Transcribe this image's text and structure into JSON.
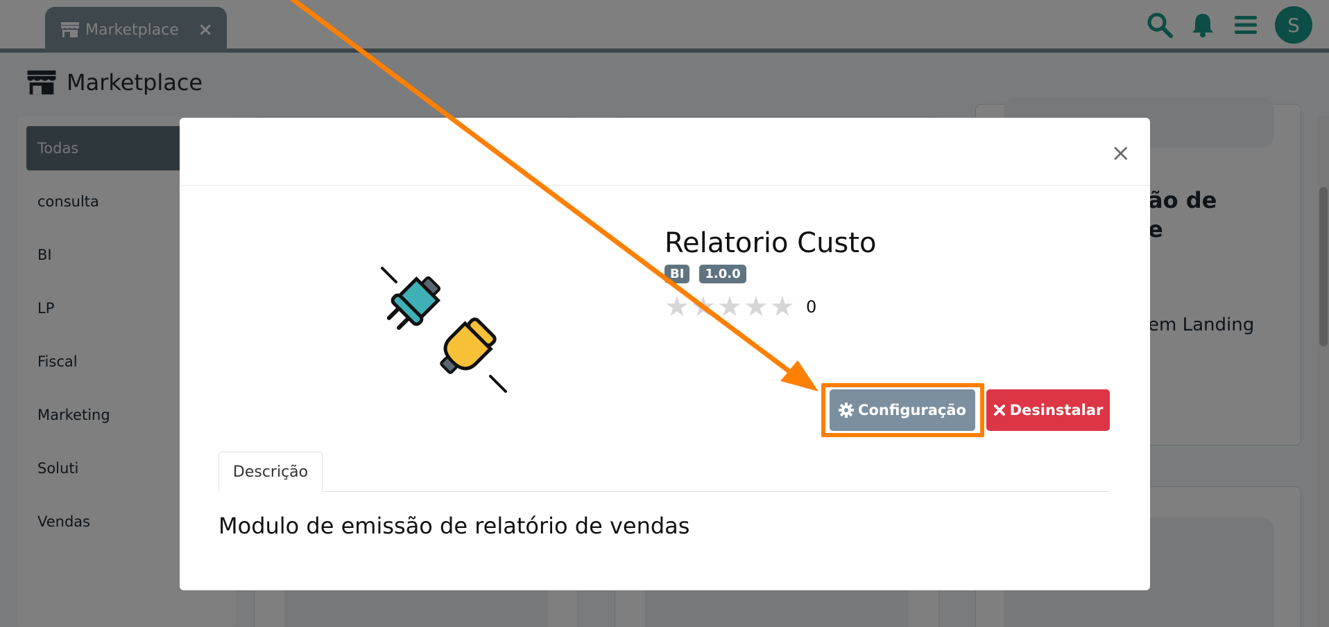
{
  "topbar": {
    "tab_label": "Marketplace",
    "tab_close": "×",
    "avatar_initial": "S"
  },
  "page": {
    "title": "Marketplace"
  },
  "sidebar": {
    "items": [
      {
        "label": "Todas",
        "active": true
      },
      {
        "label": "consulta"
      },
      {
        "label": "BI"
      },
      {
        "label": "LP"
      },
      {
        "label": "Fiscal"
      },
      {
        "label": "Marketing"
      },
      {
        "label": "Soluti"
      },
      {
        "label": "Vendas"
      }
    ]
  },
  "background": {
    "card_title_partial_1": "ão de",
    "card_title_partial_2": "e",
    "card_subtitle_partial": "em Landing"
  },
  "modal": {
    "close": "×",
    "app_title": "Relatorio Custo",
    "badges": [
      "BI",
      "1.0.0"
    ],
    "rating_count": "0",
    "config_button": "Configuração",
    "uninstall_button": "Desinstalar",
    "tab_description": "Descrição",
    "description": "Modulo de emissão de relatório de vendas"
  },
  "colors": {
    "accent_teal": "#189b8a",
    "tab_bg": "#7b8f99",
    "danger": "#dc3545",
    "highlight": "#ff7f00"
  }
}
